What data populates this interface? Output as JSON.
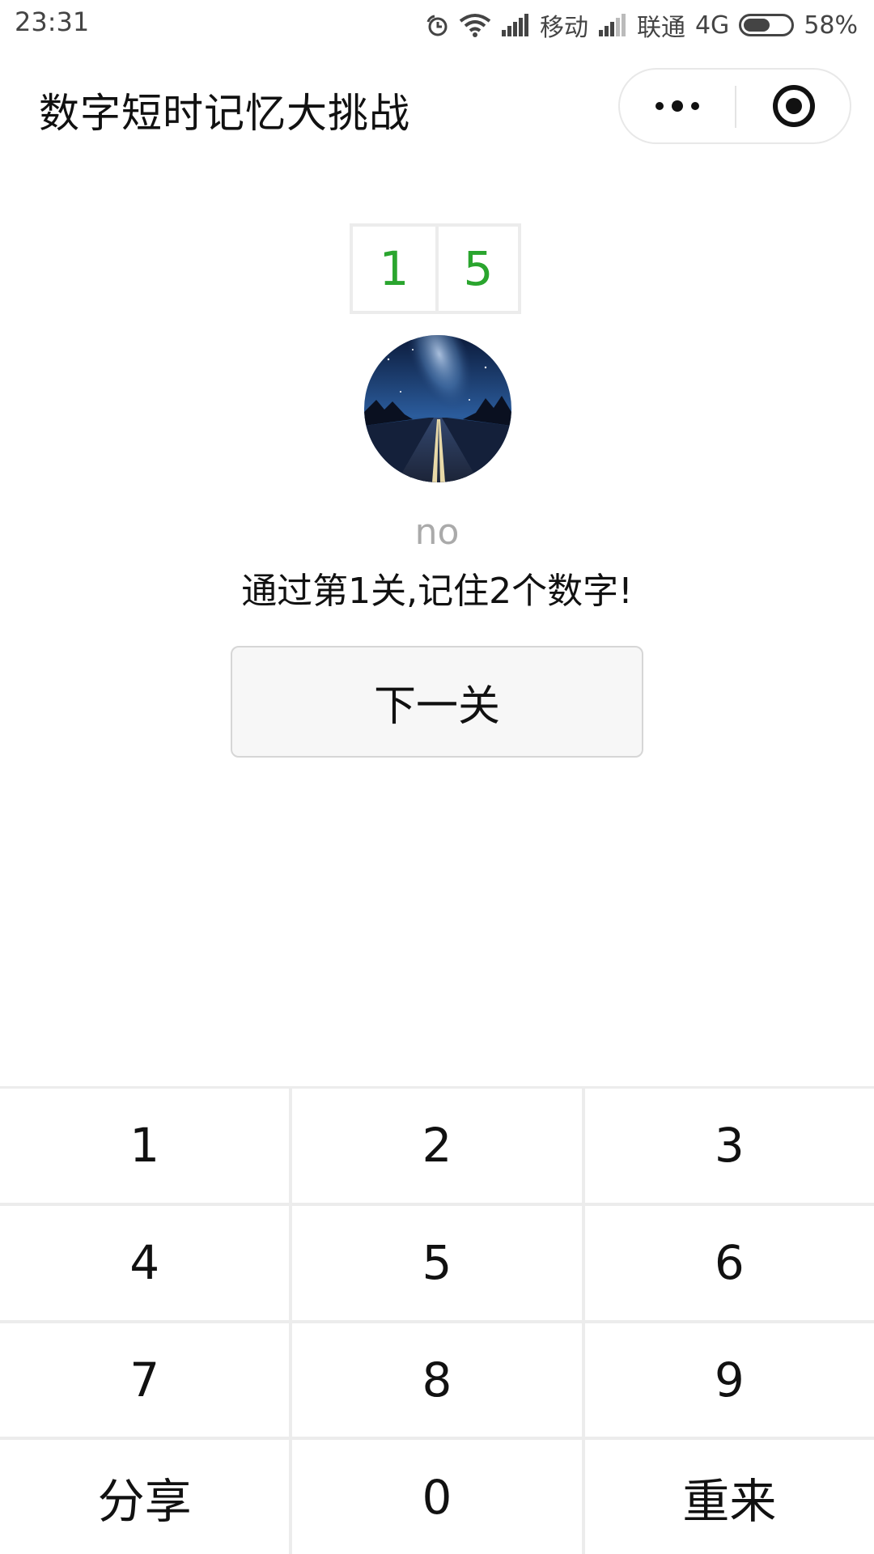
{
  "status_bar": {
    "time": "23:31",
    "carrier1": "移动",
    "carrier2": "联通",
    "network": "4G",
    "battery_percent": "58%",
    "battery_level": 0.58
  },
  "nav": {
    "title": "数字短时记忆大挑战",
    "more_icon": "more-dots-icon",
    "close_icon": "target-close-icon"
  },
  "digits": [
    "1",
    "5"
  ],
  "colors": {
    "digit": "#2aa52e",
    "username": "#aaaaaa"
  },
  "avatar": {
    "icon": "avatar-night-road-image"
  },
  "username": "no",
  "result_message": "通过第1关,记住2个数字!",
  "next_button": "下一关",
  "keypad": {
    "keys": [
      "1",
      "2",
      "3",
      "4",
      "5",
      "6",
      "7",
      "8",
      "9",
      "分享",
      "0",
      "重来"
    ]
  }
}
